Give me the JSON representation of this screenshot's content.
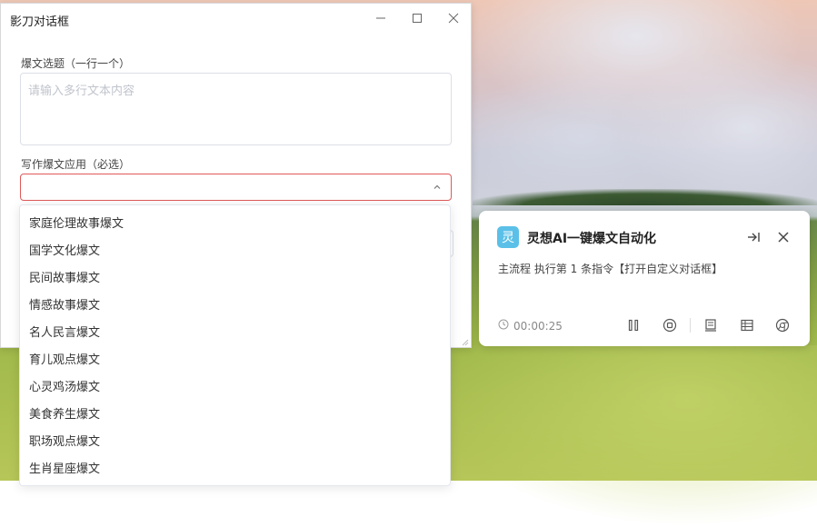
{
  "dialog": {
    "title": "影刀对话框",
    "topic_label": "爆文选题（一行一个）",
    "topic_placeholder": "请输入多行文本内容",
    "app_label": "写作爆文应用（必选）",
    "app_value": "",
    "dropdown_options": [
      "家庭伦理故事爆文",
      "国学文化爆文",
      "民间故事爆文",
      "情感故事爆文",
      "名人民言爆文",
      "育儿观点爆文",
      "心灵鸡汤爆文",
      "美食养生爆文",
      "职场观点爆文",
      "生肖星座爆文"
    ]
  },
  "notification": {
    "logo_char": "灵",
    "title": "灵想AI一键爆文自动化",
    "message": "主流程 执行第 1 条指令【打开自定义对话框】",
    "elapsed": "00:00:25"
  },
  "colors": {
    "accent": "#5bc0e8",
    "error_border": "#e05a5a",
    "placeholder": "#c0c4cc"
  },
  "icons": {
    "window": [
      "minimize-icon",
      "maximize-icon",
      "close-icon"
    ],
    "notification": [
      "collapse-right-icon",
      "close-icon"
    ],
    "toolbar": [
      "pause-icon",
      "stop-icon",
      "log-icon",
      "table-icon",
      "browser-icon"
    ]
  }
}
